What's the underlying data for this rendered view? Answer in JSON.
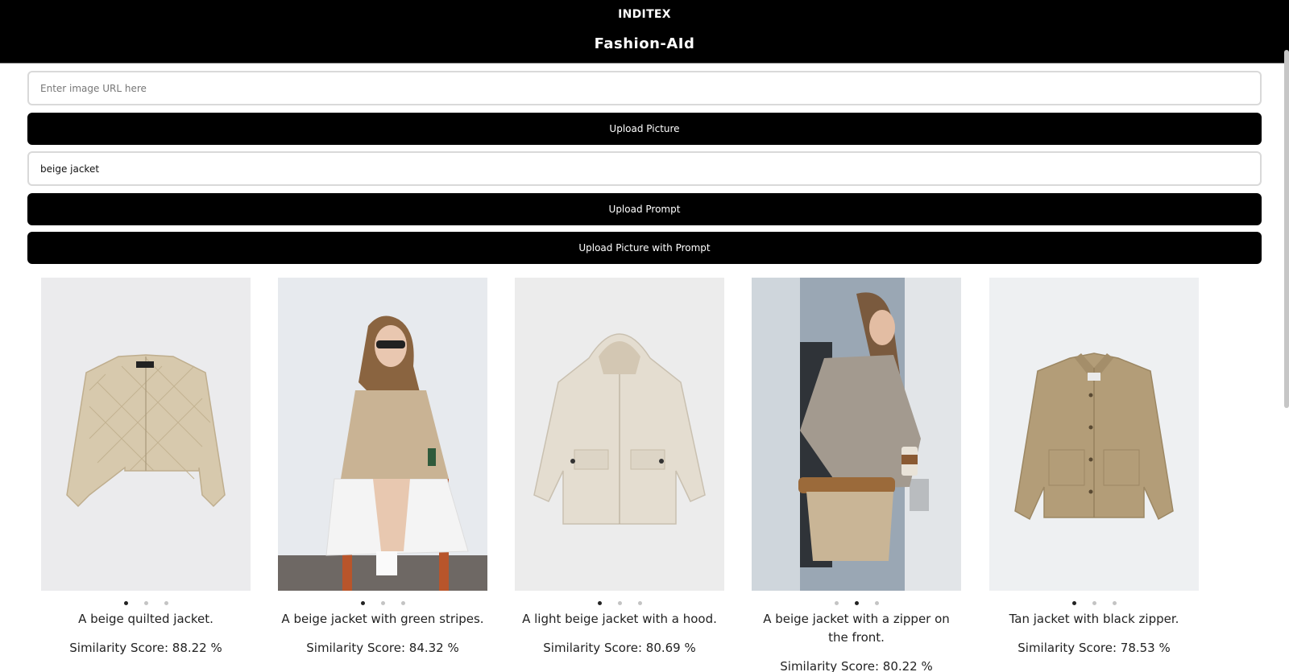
{
  "header": {
    "brand": "INDITEX",
    "title": "Fashion-AId"
  },
  "url_input": {
    "placeholder": "Enter image URL here",
    "value": ""
  },
  "prompt_input": {
    "placeholder": "",
    "value": "beige jacket"
  },
  "buttons": {
    "upload_picture": "Upload Picture",
    "upload_prompt": "Upload Prompt",
    "upload_picture_with_prompt": "Upload Picture with Prompt"
  },
  "results": [
    {
      "description": "A beige quilted jacket.",
      "score": "Similarity Score: 88.22 %",
      "active_dot": 0
    },
    {
      "description": "A beige jacket with green stripes.",
      "score": "Similarity Score: 84.32 %",
      "active_dot": 0
    },
    {
      "description": "A light beige jacket with a hood.",
      "score": "Similarity Score: 80.69 %",
      "active_dot": 0
    },
    {
      "description": "A beige jacket with a zipper on the front.",
      "score": "Similarity Score: 80.22 %",
      "active_dot": 1
    },
    {
      "description": "Tan jacket with black zipper.",
      "score": "Similarity Score: 78.53 %",
      "active_dot": 0
    }
  ],
  "colors": {
    "header_bg": "#000000",
    "button_bg": "#000000",
    "jacket_beige": "#d7c9ad",
    "jacket_tan": "#b39d78"
  }
}
